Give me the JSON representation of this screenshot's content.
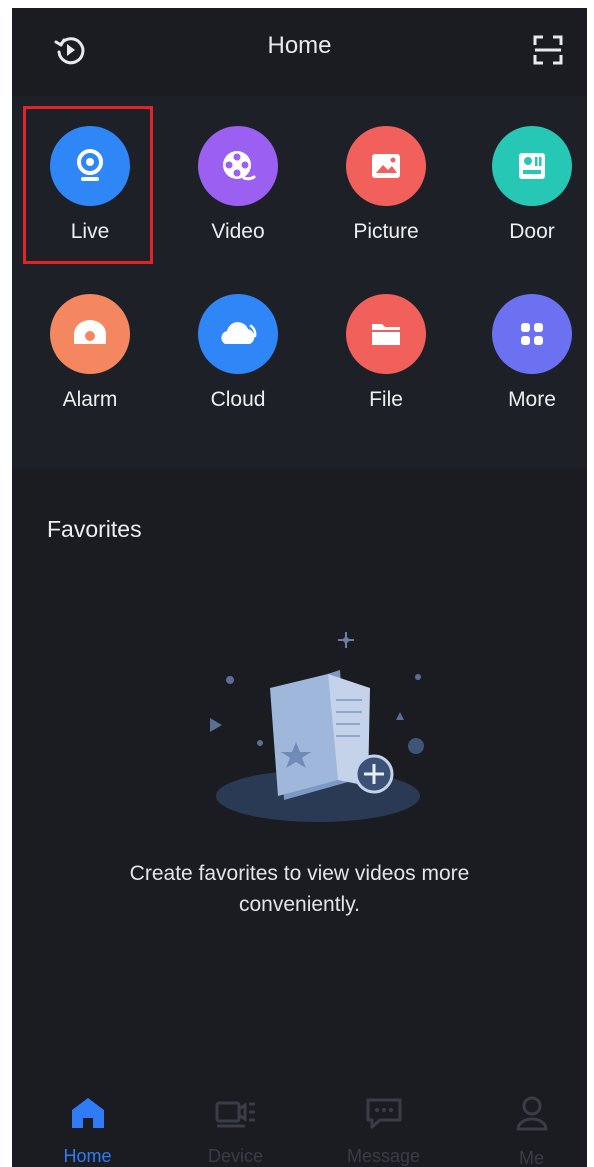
{
  "header": {
    "title": "Home",
    "left_icon": "playback-history-icon",
    "right_icon": "scan-icon"
  },
  "features": [
    {
      "label": "Live",
      "icon": "camera-icon",
      "color": "#2f86f6",
      "highlighted": true
    },
    {
      "label": "Video",
      "icon": "film-reel-icon",
      "color": "#9b5ff2"
    },
    {
      "label": "Picture",
      "icon": "picture-icon",
      "color": "#f1605b"
    },
    {
      "label": "Door",
      "icon": "door-intercom-icon",
      "color": "#27c7b5"
    },
    {
      "label": "Alarm",
      "icon": "alarm-icon",
      "color": "#f4875f"
    },
    {
      "label": "Cloud",
      "icon": "cloud-icon",
      "color": "#2f86f6"
    },
    {
      "label": "File",
      "icon": "folder-icon",
      "color": "#f1605b"
    },
    {
      "label": "More",
      "icon": "grid-icon",
      "color": "#6b71f0"
    }
  ],
  "favorites": {
    "title": "Favorites",
    "empty_message": "Create favorites to view videos more conveniently."
  },
  "tabs": [
    {
      "label": "Home",
      "icon": "home-icon",
      "active": true
    },
    {
      "label": "Device",
      "icon": "device-icon",
      "active": false
    },
    {
      "label": "Message",
      "icon": "message-icon",
      "active": false
    },
    {
      "label": "Me",
      "icon": "person-icon",
      "active": false
    }
  ],
  "colors": {
    "background": "#1a1c22",
    "panel": "#1e2027",
    "accent": "#2f7cf6",
    "highlight_box": "#e0252a"
  }
}
